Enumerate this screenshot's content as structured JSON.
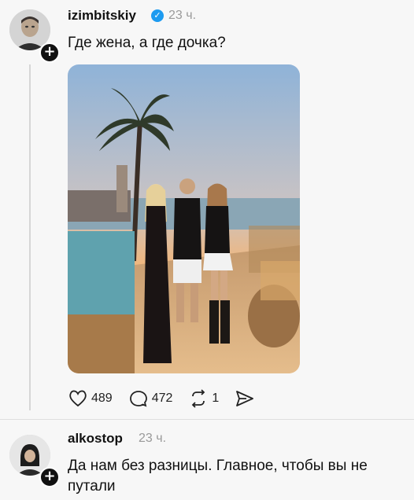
{
  "post": {
    "username": "izimbitskiy",
    "time": "23 ч.",
    "text": "Где жена, а где дочка?",
    "follow_glyph": "+",
    "verified_glyph": "✓",
    "avatar_icon": "user-avatar-icon",
    "stats": {
      "likes": "489",
      "comments": "472",
      "reposts": "1"
    }
  },
  "reply": {
    "username": "alkostop",
    "time": "23 ч.",
    "text_line1": "Да нам без разницы. Главное, чтобы вы не",
    "text_line2": "путали",
    "follow_glyph": "+"
  },
  "colors": {
    "verified": "#1d9bf0",
    "muted": "#9a9a9a",
    "accent": "#111111"
  }
}
